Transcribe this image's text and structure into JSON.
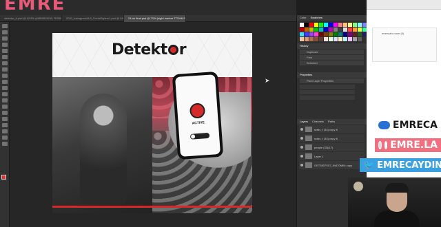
{
  "banner": {
    "name": "EMRE"
  },
  "tabs": [
    {
      "label": "detektor_h.psd @ 32.8% (#0B00D9Z43, RGB/8)"
    },
    {
      "label": "2020_Instagram16:9_SocialStylerx1.psd @ 33% (DETTES, RGB)"
    },
    {
      "label": "24-on final.psd @ 72% (night marker TTS4443, RGB/8)"
    }
  ],
  "artboard": {
    "logo_text_a": "Detekt",
    "logo_text_b": "r",
    "phone_label": "ACTIVE"
  },
  "panels": {
    "swatch_tabs": [
      "Color",
      "Swatches"
    ],
    "history_title": "History",
    "history_items": [
      "Duplicate",
      "Free",
      "Selected"
    ],
    "properties_title": "Properties",
    "properties_sub": "Pixel Layer Properties",
    "layers_tabs": [
      "Layers",
      "Channels",
      "Paths"
    ],
    "layers": [
      {
        "name": "sctav_t (33) copy 8"
      },
      {
        "name": "sctav_t (33) copy 8"
      },
      {
        "name": "people (33)(17)"
      },
      {
        "name": "Layer 1"
      },
      {
        "name": "GET3507SS7_IN470MKk copy"
      }
    ],
    "swatch_colors": [
      "#ffffff",
      "#000000",
      "#ff0000",
      "#ffff00",
      "#00ff00",
      "#00ffff",
      "#0000ff",
      "#ff00ff",
      "#ff8080",
      "#ffc080",
      "#ffff80",
      "#80ff80",
      "#80ffff",
      "#8080ff",
      "#c00000",
      "#c06000",
      "#c0c000",
      "#00c000",
      "#00c0c0",
      "#0000c0",
      "#c000c0",
      "#808080",
      "#404040",
      "#e0e0e0",
      "#ff4040",
      "#ff9f40",
      "#dfff40",
      "#40ff9f",
      "#40dfff",
      "#4040ff",
      "#9f40ff",
      "#ff40df",
      "#800000",
      "#804000",
      "#808000",
      "#008000",
      "#008080",
      "#000080",
      "#800080",
      "#602020",
      "#206020",
      "#202060",
      "#f2c6a0",
      "#d89a70",
      "#b07050",
      "#80503a",
      "#604030",
      "#ffe0e0",
      "#e0ffe0",
      "#e0e0ff",
      "#fff0c0",
      "#c0f0ff",
      "#f0c0ff",
      "#a0a0a0",
      "#606060",
      "#303030"
    ]
  },
  "rightcol": {
    "email": "emreca's room (0)"
  },
  "social": {
    "brand": "EMRECA",
    "instagram": "EMRE.LA",
    "twitter": "EMRECAYDIN"
  },
  "icons": [
    "cursor-arrow-icon",
    "steam-icon",
    "instagram-icon",
    "spotify-icon",
    "twitter-icon"
  ]
}
